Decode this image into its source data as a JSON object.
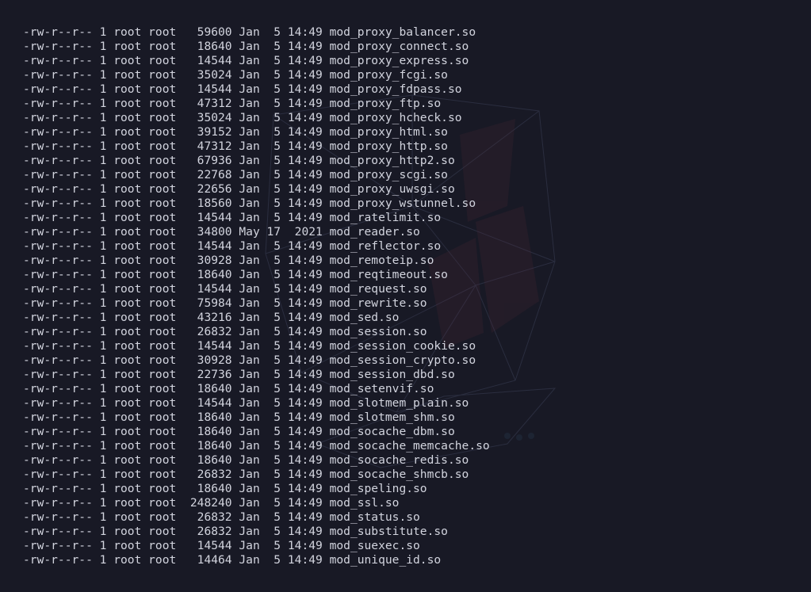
{
  "terminal": {
    "theme": {
      "background": "#181925",
      "foreground": "#d2d4de"
    },
    "wallpaper": "faint-polygon-hacker-figure",
    "lines": [
      "-rw-r--r-- 1 root root   59600 Jan  5 14:49 mod_proxy_balancer.so",
      "-rw-r--r-- 1 root root   18640 Jan  5 14:49 mod_proxy_connect.so",
      "-rw-r--r-- 1 root root   14544 Jan  5 14:49 mod_proxy_express.so",
      "-rw-r--r-- 1 root root   35024 Jan  5 14:49 mod_proxy_fcgi.so",
      "-rw-r--r-- 1 root root   14544 Jan  5 14:49 mod_proxy_fdpass.so",
      "-rw-r--r-- 1 root root   47312 Jan  5 14:49 mod_proxy_ftp.so",
      "-rw-r--r-- 1 root root   35024 Jan  5 14:49 mod_proxy_hcheck.so",
      "-rw-r--r-- 1 root root   39152 Jan  5 14:49 mod_proxy_html.so",
      "-rw-r--r-- 1 root root   47312 Jan  5 14:49 mod_proxy_http.so",
      "-rw-r--r-- 1 root root   67936 Jan  5 14:49 mod_proxy_http2.so",
      "-rw-r--r-- 1 root root   22768 Jan  5 14:49 mod_proxy_scgi.so",
      "-rw-r--r-- 1 root root   22656 Jan  5 14:49 mod_proxy_uwsgi.so",
      "-rw-r--r-- 1 root root   18560 Jan  5 14:49 mod_proxy_wstunnel.so",
      "-rw-r--r-- 1 root root   14544 Jan  5 14:49 mod_ratelimit.so",
      "-rw-r--r-- 1 root root   34800 May 17  2021 mod_reader.so",
      "-rw-r--r-- 1 root root   14544 Jan  5 14:49 mod_reflector.so",
      "-rw-r--r-- 1 root root   30928 Jan  5 14:49 mod_remoteip.so",
      "-rw-r--r-- 1 root root   18640 Jan  5 14:49 mod_reqtimeout.so",
      "-rw-r--r-- 1 root root   14544 Jan  5 14:49 mod_request.so",
      "-rw-r--r-- 1 root root   75984 Jan  5 14:49 mod_rewrite.so",
      "-rw-r--r-- 1 root root   43216 Jan  5 14:49 mod_sed.so",
      "-rw-r--r-- 1 root root   26832 Jan  5 14:49 mod_session.so",
      "-rw-r--r-- 1 root root   14544 Jan  5 14:49 mod_session_cookie.so",
      "-rw-r--r-- 1 root root   30928 Jan  5 14:49 mod_session_crypto.so",
      "-rw-r--r-- 1 root root   22736 Jan  5 14:49 mod_session_dbd.so",
      "-rw-r--r-- 1 root root   18640 Jan  5 14:49 mod_setenvif.so",
      "-rw-r--r-- 1 root root   14544 Jan  5 14:49 mod_slotmem_plain.so",
      "-rw-r--r-- 1 root root   18640 Jan  5 14:49 mod_slotmem_shm.so",
      "-rw-r--r-- 1 root root   18640 Jan  5 14:49 mod_socache_dbm.so",
      "-rw-r--r-- 1 root root   18640 Jan  5 14:49 mod_socache_memcache.so",
      "-rw-r--r-- 1 root root   18640 Jan  5 14:49 mod_socache_redis.so",
      "-rw-r--r-- 1 root root   26832 Jan  5 14:49 mod_socache_shmcb.so",
      "-rw-r--r-- 1 root root   18640 Jan  5 14:49 mod_speling.so",
      "-rw-r--r-- 1 root root  248240 Jan  5 14:49 mod_ssl.so",
      "-rw-r--r-- 1 root root   26832 Jan  5 14:49 mod_status.so",
      "-rw-r--r-- 1 root root   26832 Jan  5 14:49 mod_substitute.so",
      "-rw-r--r-- 1 root root   14544 Jan  5 14:49 mod_suexec.so",
      "-rw-r--r-- 1 root root   14464 Jan  5 14:49 mod_unique_id.so"
    ]
  }
}
